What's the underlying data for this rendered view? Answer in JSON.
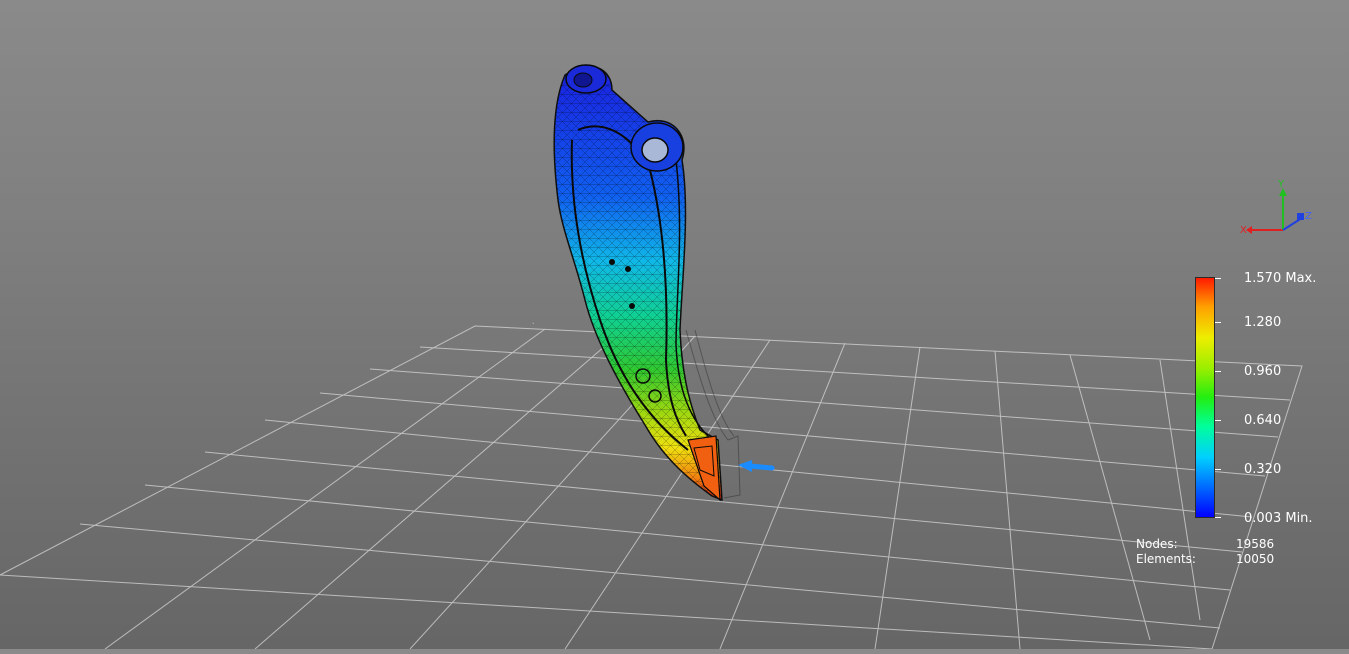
{
  "legend": {
    "max_label": "1.570 Max.",
    "min_label": "0.003 Min.",
    "ticks": [
      "1.280",
      "0.960",
      "0.640",
      "0.320"
    ],
    "colors": [
      "#0000ff",
      "#00d0ff",
      "#22ee11",
      "#eeee00",
      "#ff1a00"
    ]
  },
  "stats": {
    "nodes_label": "Nodes:",
    "nodes_value": "19586",
    "elements_label": "Elements:",
    "elements_value": "10050"
  },
  "triad": {
    "x_label": "X",
    "y_label": "Y",
    "z_label": "Z"
  },
  "load_arrow_icon": "arrow-left-icon"
}
